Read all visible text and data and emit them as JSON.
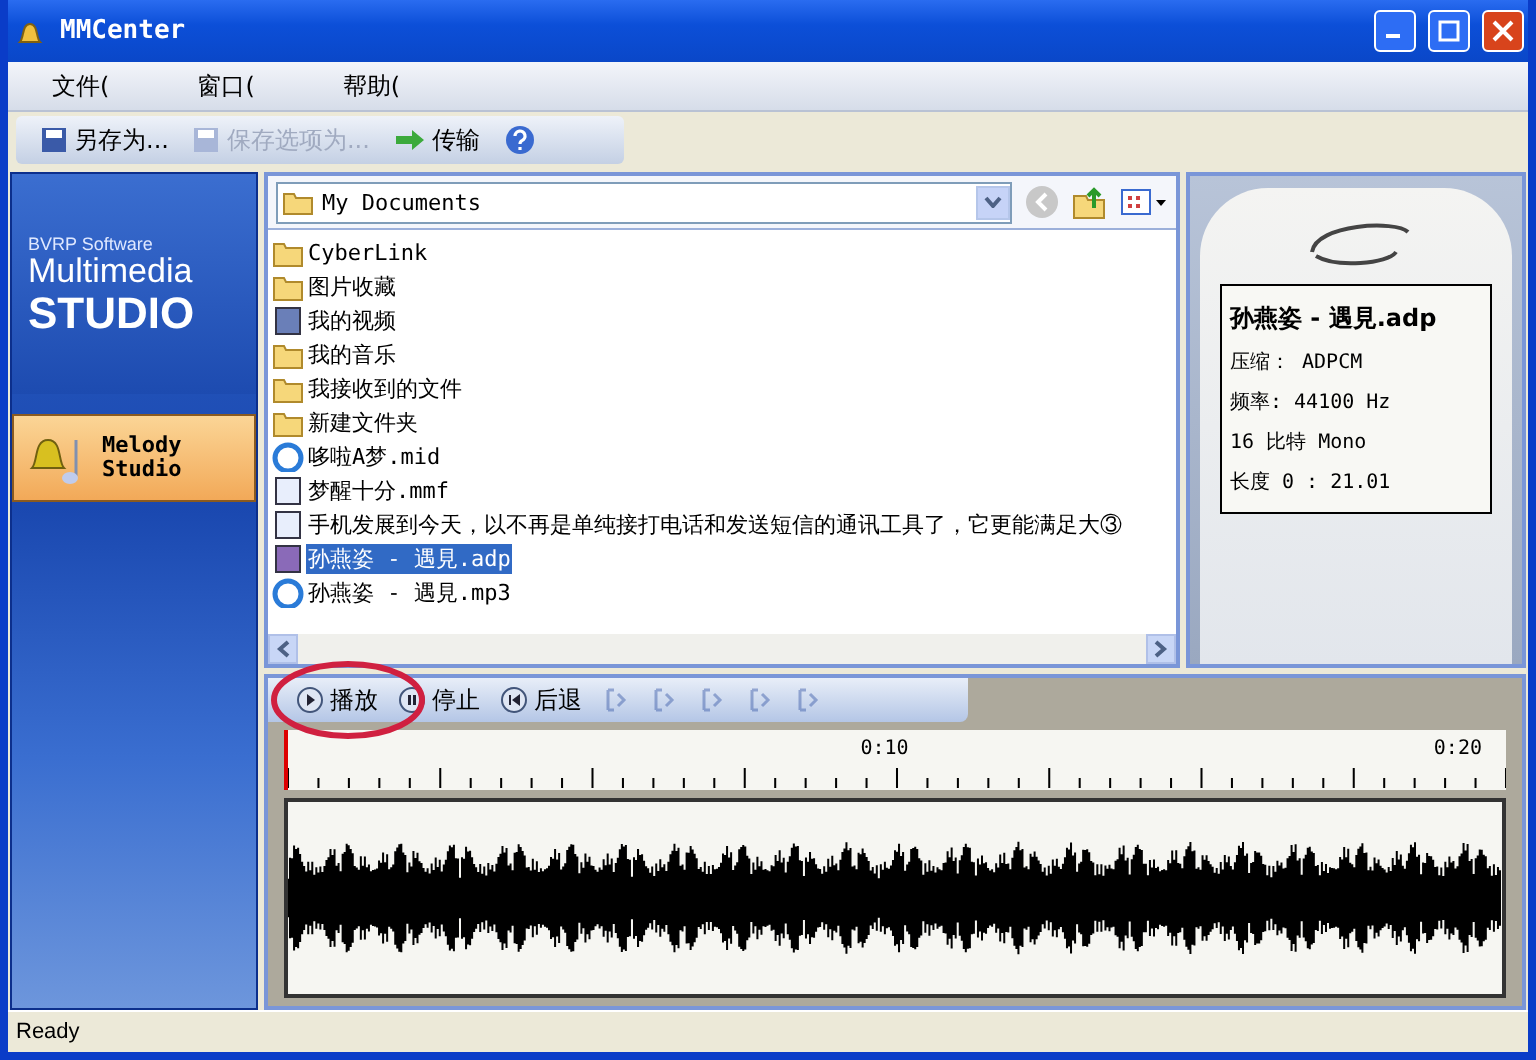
{
  "window": {
    "title": "MMCenter"
  },
  "menu": [
    {
      "label": "文件("
    },
    {
      "label": "窗口("
    },
    {
      "label": "帮助("
    }
  ],
  "toolbar": [
    {
      "kind": "save",
      "label": "另存为...",
      "disabled": false
    },
    {
      "kind": "save",
      "label": "保存选项为...",
      "disabled": true
    },
    {
      "kind": "transfer",
      "label": "传输",
      "disabled": false
    },
    {
      "kind": "help"
    }
  ],
  "sidebar": {
    "brand": "BVRP Software",
    "product_line": "Multimedia",
    "product": "STUDIO",
    "items": [
      {
        "label": "Melody Studio",
        "selected": true
      }
    ]
  },
  "browser": {
    "location": "My Documents",
    "files": [
      {
        "kind": "folder",
        "name": "CyberLink",
        "selected": false
      },
      {
        "kind": "pictures",
        "name": "图片收藏",
        "selected": false
      },
      {
        "kind": "video",
        "name": "我的视频",
        "selected": false
      },
      {
        "kind": "music",
        "name": "我的音乐",
        "selected": false
      },
      {
        "kind": "folder",
        "name": "我接收到的文件",
        "selected": false
      },
      {
        "kind": "folder",
        "name": "新建文件夹",
        "selected": false
      },
      {
        "kind": "media",
        "name": "哆啦A梦.mid",
        "selected": false
      },
      {
        "kind": "mmf",
        "name": "梦醒十分.mmf",
        "selected": false
      },
      {
        "kind": "doc",
        "name": "手机发展到今天，以不再是单纯接打电话和发送短信的通讯工具了，它更能满足大③",
        "selected": false
      },
      {
        "kind": "adp",
        "name": "孙燕姿 - 遇見.adp",
        "selected": true
      },
      {
        "kind": "media",
        "name": "孙燕姿 - 遇見.mp3",
        "selected": false
      }
    ]
  },
  "preview": {
    "title": "孙燕姿 - 遇見.adp",
    "lines": [
      "压缩： ADPCM",
      "频率: 44100 Hz",
      "16 比特 Mono",
      "长度  0 : 21.01"
    ]
  },
  "player": {
    "buttons": [
      {
        "kind": "play",
        "label": "播放",
        "disabled": false
      },
      {
        "kind": "stop",
        "label": "停止",
        "disabled": false
      },
      {
        "kind": "back",
        "label": "后退",
        "disabled": false
      },
      {
        "kind": "select-all",
        "disabled": true
      },
      {
        "kind": "mark-in",
        "disabled": true
      },
      {
        "kind": "mark-out",
        "disabled": true
      },
      {
        "kind": "prev",
        "disabled": true
      },
      {
        "kind": "next",
        "disabled": true
      }
    ],
    "ruler_labels": [
      "0:10",
      "0:20"
    ]
  },
  "status_bar": {
    "text": "Ready"
  }
}
